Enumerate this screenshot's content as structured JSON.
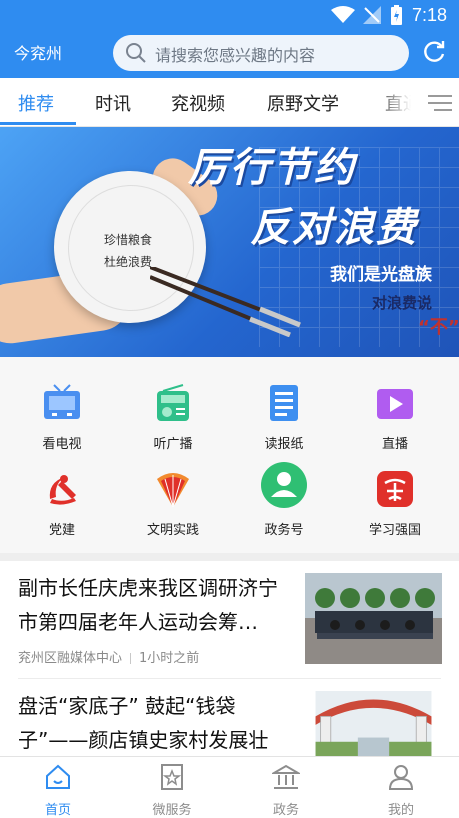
{
  "status": {
    "time": "7:18"
  },
  "header": {
    "city": "今兖州",
    "search_placeholder": "请搜索您感兴趣的内容"
  },
  "tabs": [
    {
      "label": "推荐",
      "active": true
    },
    {
      "label": "时讯"
    },
    {
      "label": "兖视频"
    },
    {
      "label": "原野文学"
    },
    {
      "label": "直通"
    }
  ],
  "banner": {
    "plate_line1": "珍惜粮食",
    "plate_line2": "杜绝浪费",
    "slogan1": "厉行节约",
    "slogan2": "反对浪费",
    "slogan3": "我们是光盘族",
    "slogan4": "对浪费说",
    "slogan5": "“不”"
  },
  "shortcuts": [
    {
      "label": "看电视",
      "icon": "tv-icon",
      "color": "#4a8ff0"
    },
    {
      "label": "听广播",
      "icon": "radio-icon",
      "color": "#2fbf8a"
    },
    {
      "label": "读报纸",
      "icon": "newspaper-icon",
      "color": "#3e8ff0"
    },
    {
      "label": "直播",
      "icon": "video-icon",
      "color": "#b05cf0"
    },
    {
      "label": "党建",
      "icon": "party-emblem-icon",
      "color": "#e0302a"
    },
    {
      "label": "文明实践",
      "icon": "fan-icon",
      "color": "#e0302a"
    },
    {
      "label": "政务号",
      "icon": "user-badge-icon",
      "color": "#2fbf73"
    },
    {
      "label": "学习强国",
      "icon": "xuexi-icon",
      "color": "#e0302a"
    }
  ],
  "news": [
    {
      "title": "副市长任庆虎来我区调研济宁市第四届老年人运动会筹…",
      "source": "兖州区融媒体中心",
      "time": "1小时之前"
    },
    {
      "title": "盘活“家底子” 鼓起“钱袋子”——颜店镇史家村发展壮大…"
    }
  ],
  "bottom_nav": [
    {
      "label": "首页",
      "icon": "home-icon",
      "active": true
    },
    {
      "label": "微服务",
      "icon": "star-bookmark-icon"
    },
    {
      "label": "政务",
      "icon": "government-icon"
    },
    {
      "label": "我的",
      "icon": "profile-icon"
    }
  ],
  "colors": {
    "primary": "#2f8cf0",
    "party_red": "#e0302a"
  }
}
